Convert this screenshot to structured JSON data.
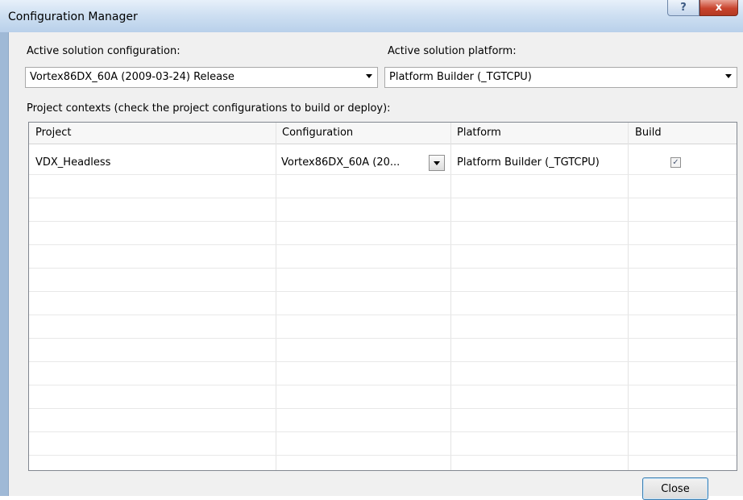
{
  "window": {
    "title": "Configuration Manager",
    "help_glyph": "?",
    "close_glyph": "x"
  },
  "active_config": {
    "label": "Active solution configuration:",
    "value": "Vortex86DX_60A (2009-03-24) Release"
  },
  "active_platform": {
    "label": "Active solution platform:",
    "value": "Platform Builder (_TGTCPU)"
  },
  "contexts": {
    "label": "Project contexts (check the project configurations to build or deploy):",
    "columns": [
      "Project",
      "Configuration",
      "Platform",
      "Build"
    ],
    "rows": [
      {
        "project": "VDX_Headless",
        "configuration": "Vortex86DX_60A (20...",
        "platform": "Platform Builder (_TGTCPU)",
        "build": true,
        "build_glyph": "✓"
      }
    ]
  },
  "buttons": {
    "close": "Close"
  }
}
